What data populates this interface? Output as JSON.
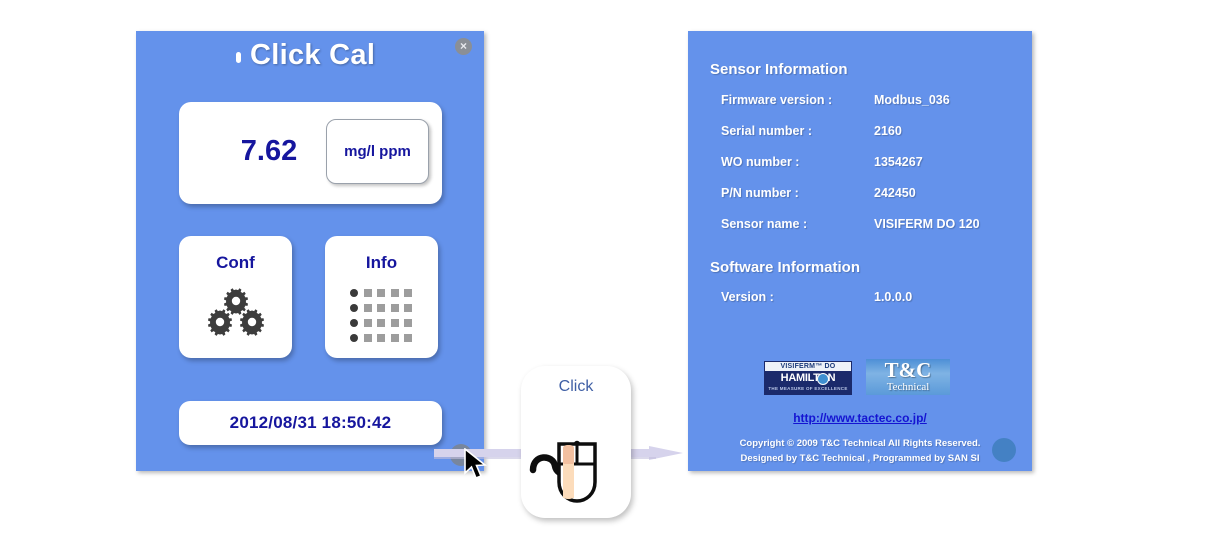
{
  "left_window": {
    "title": "Click Cal",
    "title_marker_icon": "dot-marker-icon",
    "close_icon": "close-icon",
    "close_label": "×",
    "measurement": {
      "value": "7.62",
      "unit_button_label": "mg/l ppm"
    },
    "buttons": [
      {
        "label": "Conf",
        "icon": "gears-icon"
      },
      {
        "label": "Info",
        "icon": "dot-grid-icon"
      }
    ],
    "timestamp": "2012/08/31   18:50:42",
    "resize_grip_icon": "resize-grip-icon",
    "panel_color": "#6492eb",
    "text_color": "#16169e"
  },
  "click_card": {
    "label": "Click",
    "icon": "mouse-click-icon"
  },
  "flow": {
    "arrow_icon": "right-arrow-icon",
    "arrow_color": "#d6d3ec"
  },
  "cursor": {
    "icon": "arrow-cursor-icon"
  },
  "right_window": {
    "sensor_section": {
      "heading": "Sensor Information",
      "rows": [
        {
          "label": "Firmware version  :",
          "value": "Modbus_036"
        },
        {
          "label": "Serial number   :",
          "value": "2160"
        },
        {
          "label": "WO number   :",
          "value": "1354267"
        },
        {
          "label": "P/N number   :",
          "value": "242450"
        },
        {
          "label": "Sensor name   :",
          "value": "VISIFERM DO 120"
        }
      ]
    },
    "software_section": {
      "heading": "Software Information",
      "rows": [
        {
          "label": "Version :",
          "value": "1.0.0.0"
        }
      ]
    },
    "logos": {
      "hamilton": {
        "icon": "hamilton-logo",
        "top_text": "VISIFERM™ DO",
        "main_text": "HAMILTON",
        "tagline": "THE MEASURE OF EXCELLENCE"
      },
      "tc": {
        "icon": "tc-technical-logo",
        "main_text": "T&C",
        "sub_text": "Technical"
      }
    },
    "url": "http://www.tactec.co.jp/",
    "copyright_line_1": "Copyright © 2009 T&C Technical All Rights Reserved.",
    "copyright_line_2": "Designed by T&C Technical , Programmed by SAN SI",
    "resize_grip_icon": "resize-grip-icon",
    "panel_color": "#6492eb"
  }
}
